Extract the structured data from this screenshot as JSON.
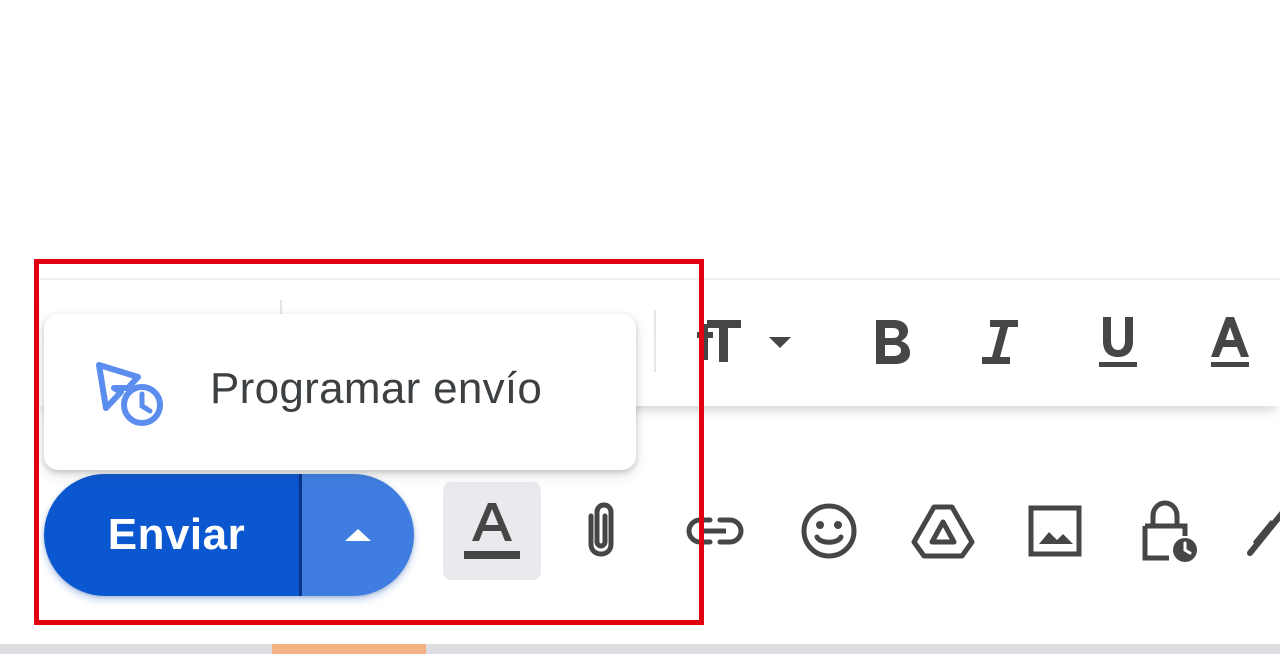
{
  "schedule_menu": {
    "item_label": "Programar envío",
    "item_icon": "schedule-send-icon"
  },
  "send": {
    "label": "Enviar",
    "more_icon": "arrow-up-icon"
  },
  "formatting_toolbar": {
    "items": [
      "text-size-icon",
      "dropdown-arrow-icon",
      "bold-icon",
      "italic-icon",
      "underline-icon",
      "text-color-icon"
    ]
  },
  "action_toolbar": {
    "items": [
      "formatting-options-icon",
      "attach-file-icon",
      "insert-link-icon",
      "insert-emoji-icon",
      "google-drive-icon",
      "insert-photo-icon",
      "confidential-mode-icon",
      "signature-icon"
    ]
  },
  "colors": {
    "send_primary": "#0b57d0",
    "send_secondary": "#3f7ee0",
    "menu_icon": "#5b8def",
    "highlight": "#e0000f",
    "icon_gray": "#444746"
  }
}
